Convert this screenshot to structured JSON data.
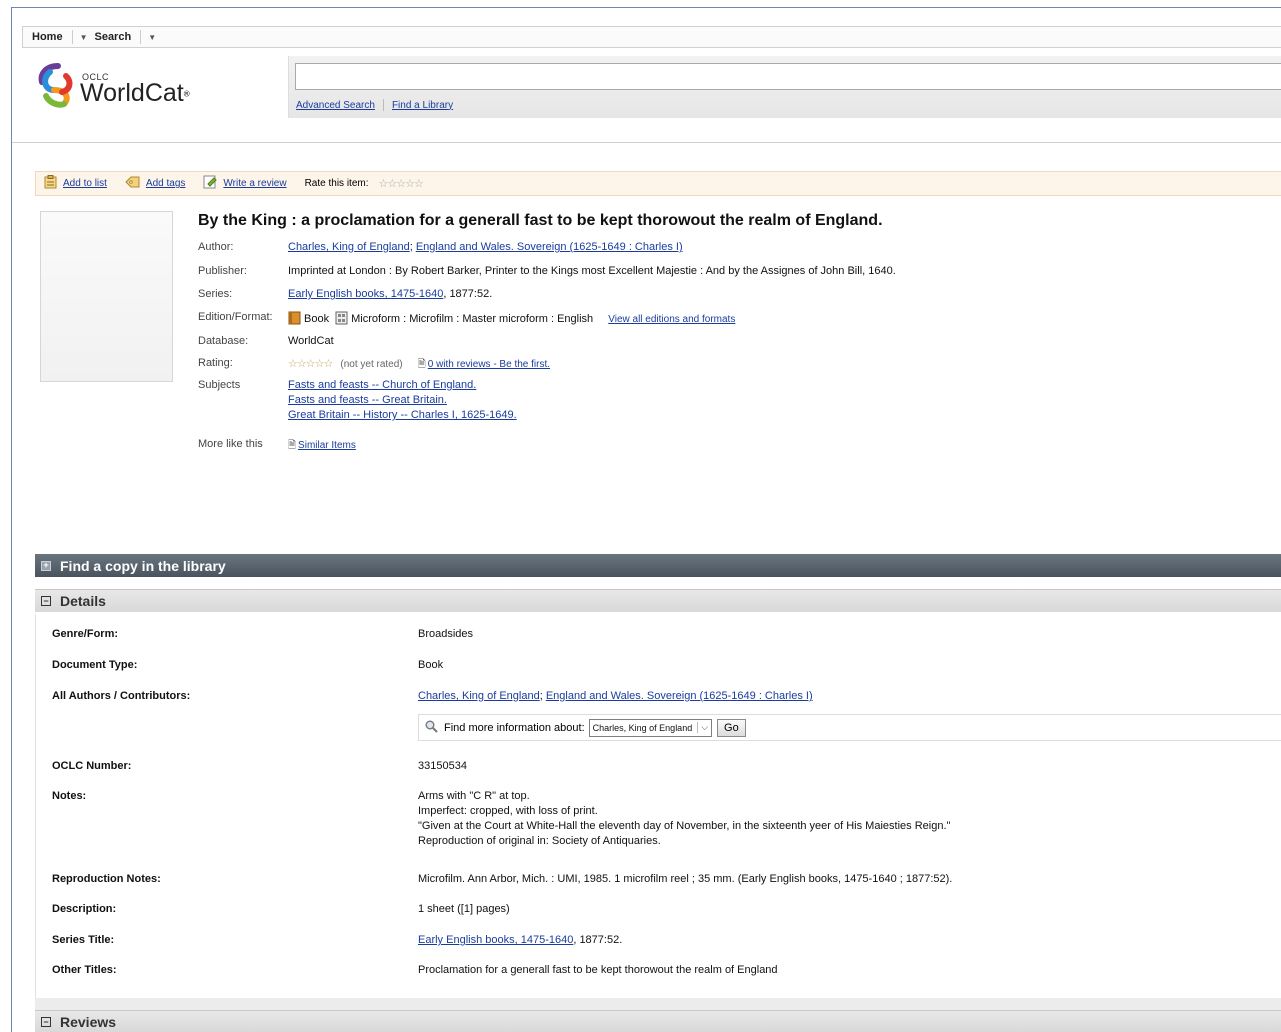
{
  "nav": {
    "home": "Home",
    "search": "Search",
    "caret": "▼"
  },
  "logo": {
    "oclc": "OCLC",
    "worldcat": "WorldCat",
    "reg": "®"
  },
  "search": {
    "value": "",
    "advanced": "Advanced Search",
    "find_library": "Find a Library"
  },
  "actions": {
    "add_list": "Add to list",
    "add_tags": "Add tags",
    "write_review": "Write a review",
    "rate_label": "Rate this item:",
    "rate_stars": "☆☆☆☆☆"
  },
  "record": {
    "title": "By the King : a proclamation for a generall fast to be kept thorowout the realm of England.",
    "author_label": "Author:",
    "author_1": "Charles, King of England",
    "author_sep": "; ",
    "author_2": "England and Wales. Sovereign (1625-1649 : Charles I)",
    "publisher_label": "Publisher:",
    "publisher": "Imprinted at London : By Robert Barker, Printer to the Kings most Excellent Majestie : And by the Assignes of John Bill, 1640.",
    "series_label": "Series:",
    "series_link": "Early English books, 1475-1640",
    "series_rest": ", 1877:52.",
    "edition_label": "Edition/Format:",
    "edition_book": "Book",
    "edition_rest": "Microform : Microfilm : Master microform : English",
    "edition_link": "View all editions and formats",
    "database_label": "Database:",
    "database": "WorldCat",
    "rating_label": "Rating:",
    "rating_stars": "☆☆☆☆☆",
    "rating_note": "(not yet rated)",
    "reviews_link": "0 with reviews - Be the first.",
    "subjects_label": "Subjects",
    "subjects": [
      "Fasts and feasts -- Church of England.",
      "Fasts and feasts -- Great Britain.",
      "Great Britain -- History -- Charles I, 1625-1649."
    ],
    "more_label": "More like this",
    "similar_link": "Similar Items"
  },
  "sections": {
    "find_copy": "Find a copy in the library",
    "details": "Details",
    "reviews": "Reviews",
    "plus": "+",
    "minus": "−"
  },
  "details": {
    "genre_label": "Genre/Form:",
    "genre": "Broadsides",
    "doctype_label": "Document Type:",
    "doctype": "Book",
    "authors_label": "All Authors / Contributors:",
    "author_1": "Charles, King of England",
    "author_sep": "; ",
    "author_2": "England and Wales. Sovereign (1625-1649 : Charles I)",
    "findmore_label": "Find more information about:",
    "findmore_selected": "Charles, King of England",
    "go": "Go",
    "oclc_label": "OCLC Number:",
    "oclc": "33150534",
    "notes_label": "Notes:",
    "notes": [
      "Arms with \"C R\" at top.",
      "Imperfect: cropped, with loss of print.",
      "\"Given at the Court at White-Hall the eleventh day of November, in the sixteenth yeer of His Maiesties Reign.\"",
      "Reproduction of original in: Society of Antiquaries."
    ],
    "repro_label": "Reproduction Notes:",
    "repro": "Microfilm. Ann Arbor, Mich. : UMI, 1985. 1 microfilm reel ; 35 mm. (Early English books, 1475-1640 ; 1877:52).",
    "desc_label": "Description:",
    "desc": "1 sheet ([1] pages)",
    "series_label": "Series Title:",
    "series_link": "Early English books, 1475-1640",
    "series_rest": ", 1877:52.",
    "other_label": "Other Titles:",
    "other": "Proclamation for a generall fast to be kept thorowout the realm of England"
  },
  "colors": {
    "link": "#1a3c9e",
    "section_dark": "#56616b",
    "action_bg": "#fdf4ea"
  }
}
